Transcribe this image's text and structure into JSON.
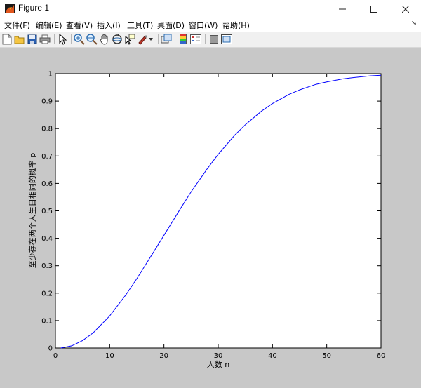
{
  "window": {
    "title": "Figure 1",
    "icon": "matlab-logo-icon"
  },
  "menu": {
    "items": [
      {
        "label": "文件(F)"
      },
      {
        "label": "编辑(E)"
      },
      {
        "label": "查看(V)"
      },
      {
        "label": "插入(I)"
      },
      {
        "label": "工具(T)"
      },
      {
        "label": "桌面(D)"
      },
      {
        "label": "窗口(W)"
      },
      {
        "label": "帮助(H)"
      }
    ]
  },
  "toolbar": {
    "buttons": [
      "new-figure-icon",
      "open-file-icon",
      "save-icon",
      "print-icon",
      "edit-plot-icon",
      "zoom-in-icon",
      "zoom-out-icon",
      "pan-icon",
      "rotate-3d-icon",
      "data-cursor-icon",
      "brush-icon",
      "link-plot-icon",
      "insert-colorbar-icon",
      "insert-legend-icon",
      "hide-plot-tools-icon",
      "show-plot-tools-icon"
    ]
  },
  "chart_data": {
    "type": "line",
    "title": "",
    "xlabel": "人数 n",
    "ylabel": "至少存在两个人生日相同的概率 p",
    "xlim": [
      0,
      60
    ],
    "ylim": [
      0,
      1
    ],
    "xticks": [
      "0",
      "10",
      "20",
      "30",
      "40",
      "50",
      "60"
    ],
    "yticks": [
      "0",
      "0.1",
      "0.2",
      "0.3",
      "0.4",
      "0.5",
      "0.6",
      "0.7",
      "0.8",
      "0.9",
      "1"
    ],
    "grid": false,
    "series": [
      {
        "color": "#0000ff",
        "x": [
          1,
          3,
          5,
          7,
          10,
          13,
          15,
          18,
          20,
          23,
          25,
          28,
          30,
          33,
          35,
          38,
          40,
          43,
          45,
          48,
          50,
          53,
          55,
          58,
          60
        ],
        "values": [
          0.0,
          0.008,
          0.027,
          0.056,
          0.117,
          0.194,
          0.253,
          0.347,
          0.411,
          0.507,
          0.569,
          0.654,
          0.706,
          0.775,
          0.814,
          0.864,
          0.891,
          0.924,
          0.941,
          0.961,
          0.97,
          0.981,
          0.986,
          0.992,
          0.994
        ]
      }
    ]
  }
}
